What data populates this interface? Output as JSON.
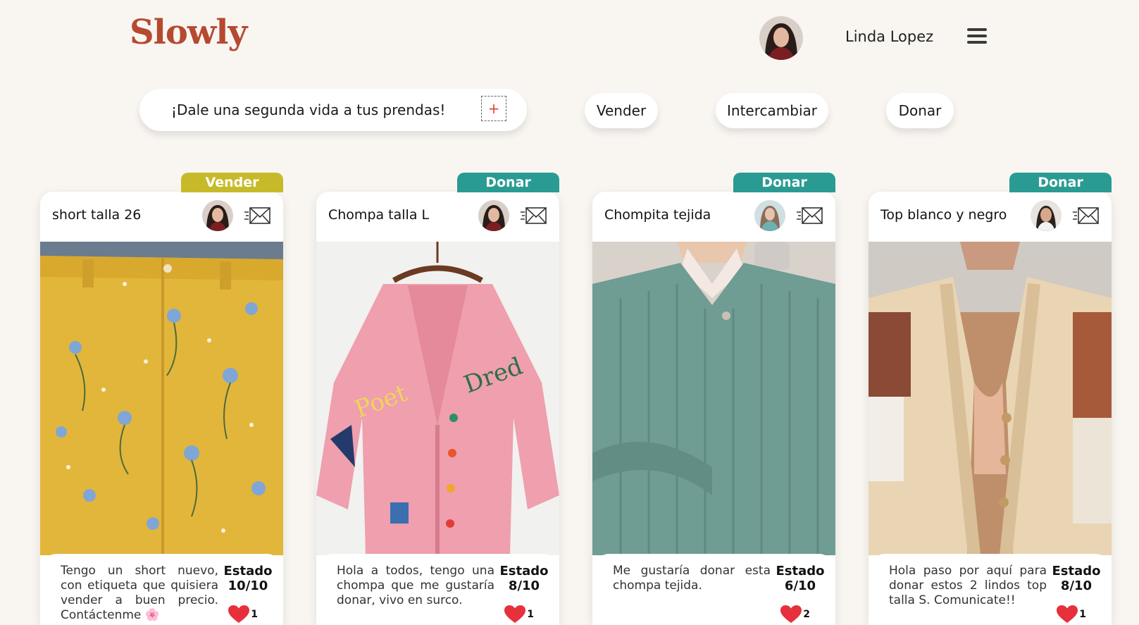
{
  "brand": "Slowly",
  "user": {
    "name": "Linda Lopez"
  },
  "search": {
    "placeholder": "¡Dale una segunda vida a tus prendas!",
    "add_symbol": "+"
  },
  "filters": {
    "sell": "Vender",
    "exchange": "Intercambiar",
    "donate": "Donar"
  },
  "colors": {
    "accent": "#b54a30",
    "sell_tag": "#c7ba2a",
    "donate_tag": "#2a9b93",
    "heart": "#e6303b"
  },
  "cards": [
    {
      "tag": "Vender",
      "title": "short talla 26",
      "description": "Tengo un short nuevo, con etiqueta que quisiera vender a buen precio. Contáctenme 🌸",
      "estado_label": "Estado",
      "estado": "10/10",
      "likes": "1"
    },
    {
      "tag": "Donar",
      "title": "Chompa talla L",
      "description": "Hola a todos, tengo una chompa que me gustaría donar, vivo en surco.",
      "estado_label": "Estado",
      "estado": "8/10",
      "likes": "1"
    },
    {
      "tag": "Donar",
      "title": "Chompita tejida",
      "description": "Me gustaría donar esta chompa tejida.",
      "estado_label": "Estado",
      "estado": "6/10",
      "likes": "2"
    },
    {
      "tag": "Donar",
      "title": "Top blanco y negro",
      "description": "Hola paso por aquí para donar estos 2 lindos top talla S. Comunicate!!",
      "estado_label": "Estado",
      "estado": "8/10",
      "likes": "1"
    }
  ]
}
